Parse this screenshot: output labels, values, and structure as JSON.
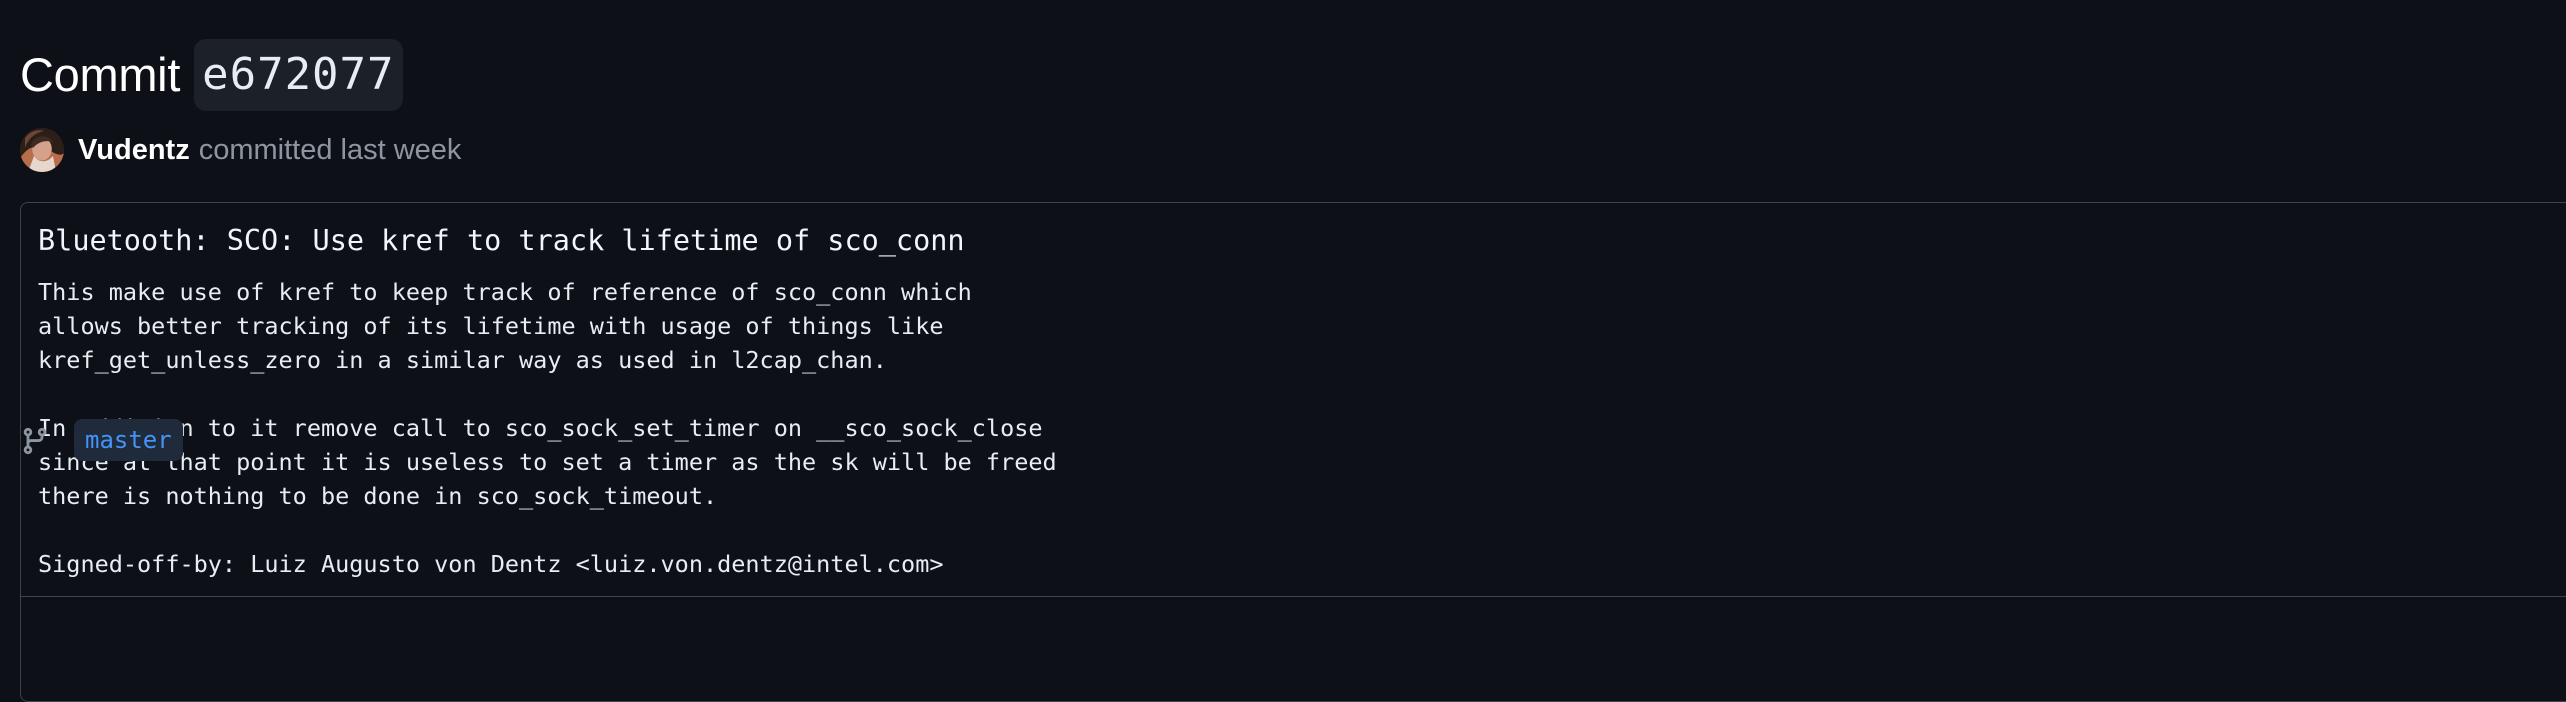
{
  "header": {
    "title": "Commit",
    "sha": "e672077"
  },
  "author": {
    "name": "Vudentz",
    "meta": "committed last week"
  },
  "commit": {
    "title": "Bluetooth: SCO: Use kref to track lifetime of sco_conn",
    "body": "This make use of kref to keep track of reference of sco_conn which\nallows better tracking of its lifetime with usage of things like\nkref_get_unless_zero in a similar way as used in l2cap_chan.\n\nIn addition to it remove call to sco_sock_set_timer on __sco_sock_close\nsince at that point it is useless to set a timer as the sk will be freed\nthere is nothing to be done in sco_sock_timeout.\n\nSigned-off-by: Luiz Augusto von Dentz <luiz.von.dentz@intel.com>"
  },
  "branch": {
    "name": "master"
  },
  "colors": {
    "background": "#0d1117",
    "border": "#3d444d",
    "muted_text": "#8d96a0",
    "branch_accent": "#4493f8"
  },
  "icons": {
    "avatar": "user-avatar",
    "branch": "git-branch-icon"
  }
}
